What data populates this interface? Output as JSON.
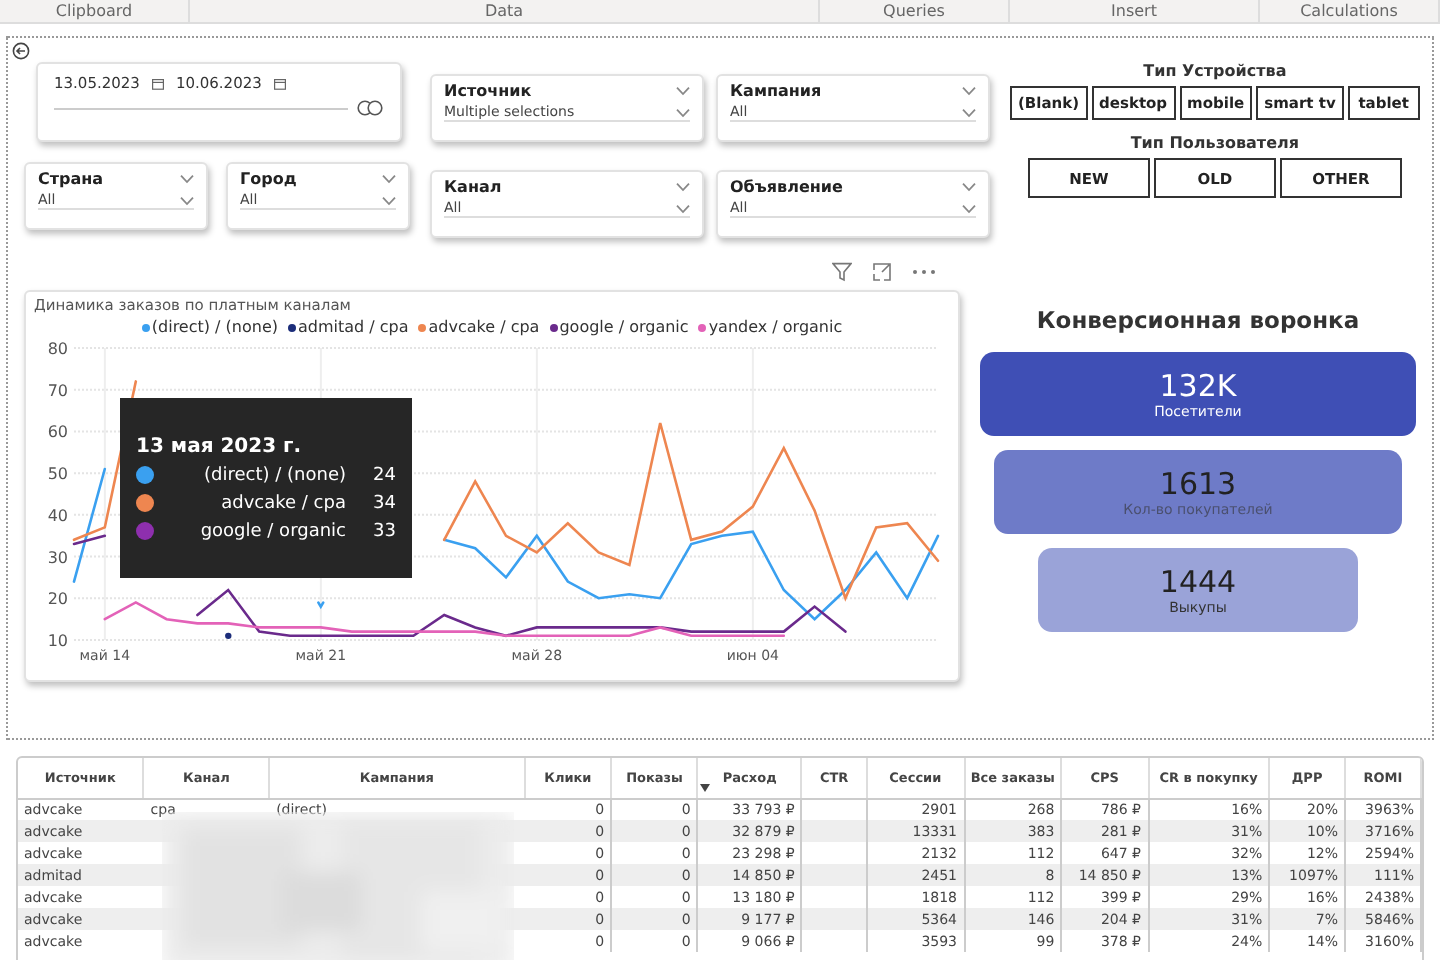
{
  "ribbon": [
    "Clipboard",
    "Data",
    "Queries",
    "Insert",
    "Calculations"
  ],
  "date_slicer": {
    "from": "13.05.2023",
    "to": "10.06.2023"
  },
  "location_slicers": [
    {
      "label": "Страна",
      "value": "All"
    },
    {
      "label": "Город",
      "value": "All"
    }
  ],
  "slicers": [
    {
      "label": "Источник",
      "value": "Multiple selections"
    },
    {
      "label": "Кампания",
      "value": "All"
    },
    {
      "label": "Канал",
      "value": "All"
    },
    {
      "label": "Объявление",
      "value": "All"
    }
  ],
  "device_type": {
    "title": "Тип Устройства",
    "options": [
      {
        "label": "(Blank)",
        "selected": false
      },
      {
        "label": "desktop",
        "selected": false
      },
      {
        "label": "mobile",
        "selected": false
      },
      {
        "label": "smart tv",
        "selected": false
      },
      {
        "label": "tablet",
        "selected": false
      }
    ]
  },
  "user_type": {
    "title": "Тип Пользователя",
    "options": [
      {
        "label": "NEW",
        "selected": false
      },
      {
        "label": "OLD",
        "selected": false
      },
      {
        "label": "OTHER",
        "selected": false
      }
    ]
  },
  "chart": {
    "chart_data": {
      "type": "line",
      "title": "Динамика заказов по платным каналам",
      "x": [
        "2023-05-13",
        "2023-05-14",
        "2023-05-15",
        "2023-05-16",
        "2023-05-17",
        "2023-05-18",
        "2023-05-19",
        "2023-05-20",
        "2023-05-21",
        "2023-05-22",
        "2023-05-23",
        "2023-05-24",
        "2023-05-25",
        "2023-05-26",
        "2023-05-27",
        "2023-05-28",
        "2023-05-29",
        "2023-05-30",
        "2023-05-31",
        "2023-06-01",
        "2023-06-02",
        "2023-06-03",
        "2023-06-04",
        "2023-06-05",
        "2023-06-06",
        "2023-06-07",
        "2023-06-08",
        "2023-06-09",
        "2023-06-10"
      ],
      "series": [
        {
          "name": "(direct) / (none)",
          "color": "#3aa0f0",
          "values": [
            24,
            51,
            null,
            null,
            null,
            null,
            null,
            null,
            18,
            null,
            null,
            null,
            34,
            32,
            25,
            35,
            24,
            20,
            21,
            20,
            33,
            35,
            36,
            22,
            15,
            22,
            31,
            20,
            35
          ]
        },
        {
          "name": "admitad / cpa",
          "color": "#1c2d7a",
          "marker": "circle",
          "values": [
            null,
            null,
            null,
            null,
            null,
            11,
            null,
            null,
            null,
            null,
            null,
            null,
            null,
            null,
            null,
            null,
            null,
            null,
            null,
            null,
            null,
            null,
            null,
            null,
            null,
            null,
            null,
            null,
            null
          ]
        },
        {
          "name": "advcake / cpa",
          "color": "#ee8650",
          "values": [
            34,
            37,
            72,
            null,
            null,
            null,
            null,
            null,
            null,
            null,
            null,
            null,
            34,
            48,
            35,
            31,
            38,
            31,
            28,
            62,
            34,
            36,
            42,
            56,
            41,
            20,
            37,
            38,
            29
          ]
        },
        {
          "name": "google / organic",
          "color": "#6a2a8c",
          "values": [
            33,
            35,
            null,
            null,
            16,
            22,
            12,
            11,
            11,
            11,
            11,
            11,
            16,
            13,
            11,
            13,
            13,
            13,
            13,
            13,
            12,
            12,
            12,
            12,
            18,
            12,
            null,
            null,
            null
          ]
        },
        {
          "name": "yandex / organic",
          "color": "#e362b8",
          "values": [
            null,
            15,
            19,
            15,
            14,
            14,
            13,
            13,
            13,
            12,
            12,
            12,
            12,
            12,
            11,
            11,
            11,
            11,
            11,
            13,
            11,
            11,
            11,
            11,
            null,
            null,
            null,
            null,
            null
          ]
        }
      ],
      "xticks": [
        {
          "value": "2023-05-14",
          "label": "май 14"
        },
        {
          "value": "2023-05-21",
          "label": "май 21"
        },
        {
          "value": "2023-05-28",
          "label": "май 28"
        },
        {
          "value": "2023-06-04",
          "label": "июн 04"
        }
      ],
      "xlim": [
        "2023-05-13",
        "2023-06-10"
      ],
      "grid": true,
      "ylim": [
        10,
        80
      ],
      "yticks": [
        10,
        20,
        30,
        40,
        50,
        60,
        70,
        80
      ]
    },
    "tooltip": {
      "title": "13 мая 2023 г.",
      "rows": [
        {
          "name": "(direct) / (none)",
          "value": "24",
          "color": "#3aa0f0"
        },
        {
          "name": "advcake / cpa",
          "value": "34",
          "color": "#ee8650"
        },
        {
          "name": "google / organic",
          "value": "33",
          "color": "#8e2fae"
        }
      ]
    }
  },
  "funnel": {
    "title": "Конверсионная воронка",
    "stages": [
      {
        "value": "132K",
        "label": "Посетители",
        "color": "#3f4fb5"
      },
      {
        "value": "1613",
        "label": "Кол-во покупателей",
        "color": "#6e7bc8"
      },
      {
        "value": "1444",
        "label": "Выкупы",
        "color": "#9aa3d8"
      }
    ]
  },
  "table": {
    "columns": [
      {
        "label": "Источник",
        "sorted": false
      },
      {
        "label": "Канал",
        "sorted": false
      },
      {
        "label": "Кампания",
        "sorted": false
      },
      {
        "label": "Клики",
        "sorted": false
      },
      {
        "label": "Показы",
        "sorted": false
      },
      {
        "label": "Расход",
        "sorted": true
      },
      {
        "label": "CTR",
        "sorted": false
      },
      {
        "label": "Сессии",
        "sorted": false
      },
      {
        "label": "Все заказы",
        "sorted": false
      },
      {
        "label": "CPS",
        "sorted": false
      },
      {
        "label": "CR в покупку",
        "sorted": false
      },
      {
        "label": "ДРР",
        "sorted": false
      },
      {
        "label": "ROMI",
        "sorted": false
      }
    ],
    "rows": [
      {
        "source": "advcake",
        "channel": "cpa",
        "campaign": "(direct)",
        "clicks": "0",
        "shows": "0",
        "spend": "33 793 ₽",
        "sessions": "2901",
        "orders": "268",
        "cps": "786 ₽",
        "cr": "16%",
        "drr": "20%",
        "romi": "3963%"
      },
      {
        "source": "advcake",
        "clicks": "0",
        "shows": "0",
        "spend": "32 879 ₽",
        "sessions": "13331",
        "orders": "383",
        "cps": "281 ₽",
        "cr": "31%",
        "drr": "10%",
        "romi": "3716%"
      },
      {
        "source": "advcake",
        "clicks": "0",
        "shows": "0",
        "spend": "23 298 ₽",
        "sessions": "2132",
        "orders": "112",
        "cps": "647 ₽",
        "cr": "32%",
        "drr": "12%",
        "romi": "2594%"
      },
      {
        "source": "admitad",
        "clicks": "0",
        "shows": "0",
        "spend": "14 850 ₽",
        "sessions": "2451",
        "orders": "8",
        "cps": "14 850 ₽",
        "cr": "13%",
        "drr": "1097%",
        "romi": "111%"
      },
      {
        "source": "advcake",
        "clicks": "0",
        "shows": "0",
        "spend": "13 180 ₽",
        "sessions": "1818",
        "orders": "112",
        "cps": "399 ₽",
        "cr": "29%",
        "drr": "16%",
        "romi": "2438%"
      },
      {
        "source": "advcake",
        "clicks": "0",
        "shows": "0",
        "spend": "9 177 ₽",
        "sessions": "5364",
        "orders": "146",
        "cps": "204 ₽",
        "cr": "31%",
        "drr": "7%",
        "romi": "5846%"
      },
      {
        "source": "advcake",
        "clicks": "0",
        "shows": "0",
        "spend": "9 066 ₽",
        "sessions": "3593",
        "orders": "99",
        "cps": "378 ₽",
        "cr": "24%",
        "drr": "14%",
        "romi": "3160%"
      }
    ]
  }
}
